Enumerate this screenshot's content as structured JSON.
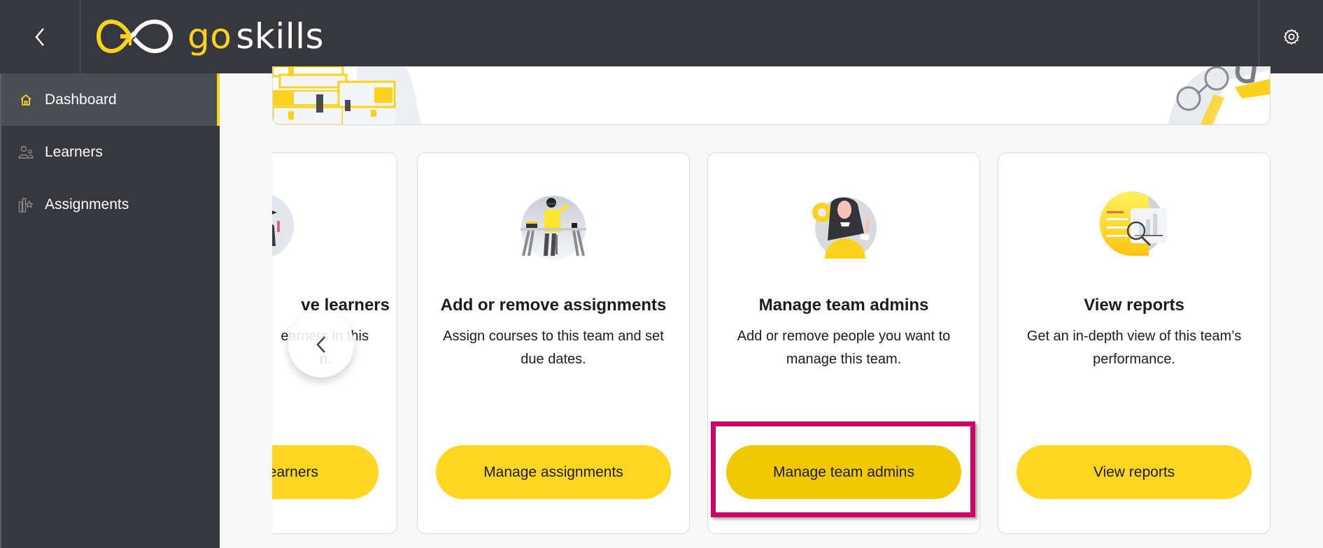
{
  "header": {
    "back_icon": "chevron-left-icon",
    "logo": {
      "part1": "go",
      "part2": "skills",
      "mark_icon": "goskills-infinity-logo"
    },
    "settings_icon": "gear-icon"
  },
  "sidebar": {
    "items": [
      {
        "label": "Dashboard",
        "icon": "home-icon",
        "active": true
      },
      {
        "label": "Learners",
        "icon": "users-icon",
        "active": false
      },
      {
        "label": "Assignments",
        "icon": "books-star-icon",
        "active": false
      }
    ]
  },
  "cards": [
    {
      "title": "ve learners",
      "desc_line1": "earners in this",
      "desc_line2": "n.",
      "button": "earners",
      "illustration": "graduates-illustration"
    },
    {
      "title": "Add or remove assignments",
      "description": "Assign courses to this team and set due dates.",
      "button": "Manage assignments",
      "illustration": "woman-at-desk-illustration"
    },
    {
      "title": "Manage team admins",
      "description": "Add or remove people you want to manage this team.",
      "button": "Manage team admins",
      "illustration": "admin-woman-gear-illustration",
      "highlighted": true
    },
    {
      "title": "View reports",
      "description": "Get an in-depth view of this team’s performance.",
      "button": "View reports",
      "illustration": "report-magnifier-illustration"
    }
  ],
  "carousel": {
    "prev_icon": "chevron-left-icon"
  },
  "colors": {
    "brand_yellow": "#fdd21f",
    "button_yellow": "#ffd622",
    "button_hover": "#f0c800",
    "dark_bg": "#37383d",
    "highlight": "#cc0066"
  }
}
